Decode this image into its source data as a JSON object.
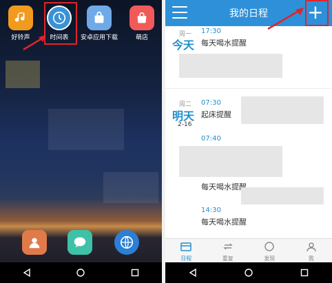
{
  "home": {
    "apps_top": [
      {
        "label": "好铃声",
        "icon": "music-note-icon"
      },
      {
        "label": "时间表",
        "icon": "clock-icon"
      },
      {
        "label": "安卓应用下载",
        "icon": "shopping-bag-icon"
      },
      {
        "label": "萌店",
        "icon": "shop-bag-icon"
      }
    ],
    "dock": [
      {
        "icon": "contacts-icon"
      },
      {
        "icon": "message-icon"
      },
      {
        "icon": "browser-globe-icon"
      }
    ]
  },
  "schedule": {
    "title": "我的日程",
    "add_symbol": "+",
    "entries": [
      {
        "day": "周一",
        "big": "今天",
        "date": "",
        "time": "17:30",
        "task": "每天喝水提醒"
      },
      {
        "day": "周二",
        "big": "明天",
        "date": "2-16",
        "time": "07:30",
        "task": "起床提醒"
      },
      {
        "day": "",
        "big": "",
        "date": "",
        "time": "07:40",
        "task": ""
      },
      {
        "day": "",
        "big": "",
        "date": "",
        "time": "",
        "task": "每天喝水提醒"
      },
      {
        "day": "",
        "big": "",
        "date": "",
        "time": "14:30",
        "task": "每天喝水提醒"
      }
    ],
    "tabs": [
      {
        "label": "日程",
        "icon": "calendar-icon"
      },
      {
        "label": "重复",
        "icon": "repeat-icon"
      },
      {
        "label": "发现",
        "icon": "compass-icon"
      },
      {
        "label": "我",
        "icon": "person-icon"
      }
    ]
  },
  "colors": {
    "accent": "#2e90d8",
    "highlight": "#e0242a"
  }
}
